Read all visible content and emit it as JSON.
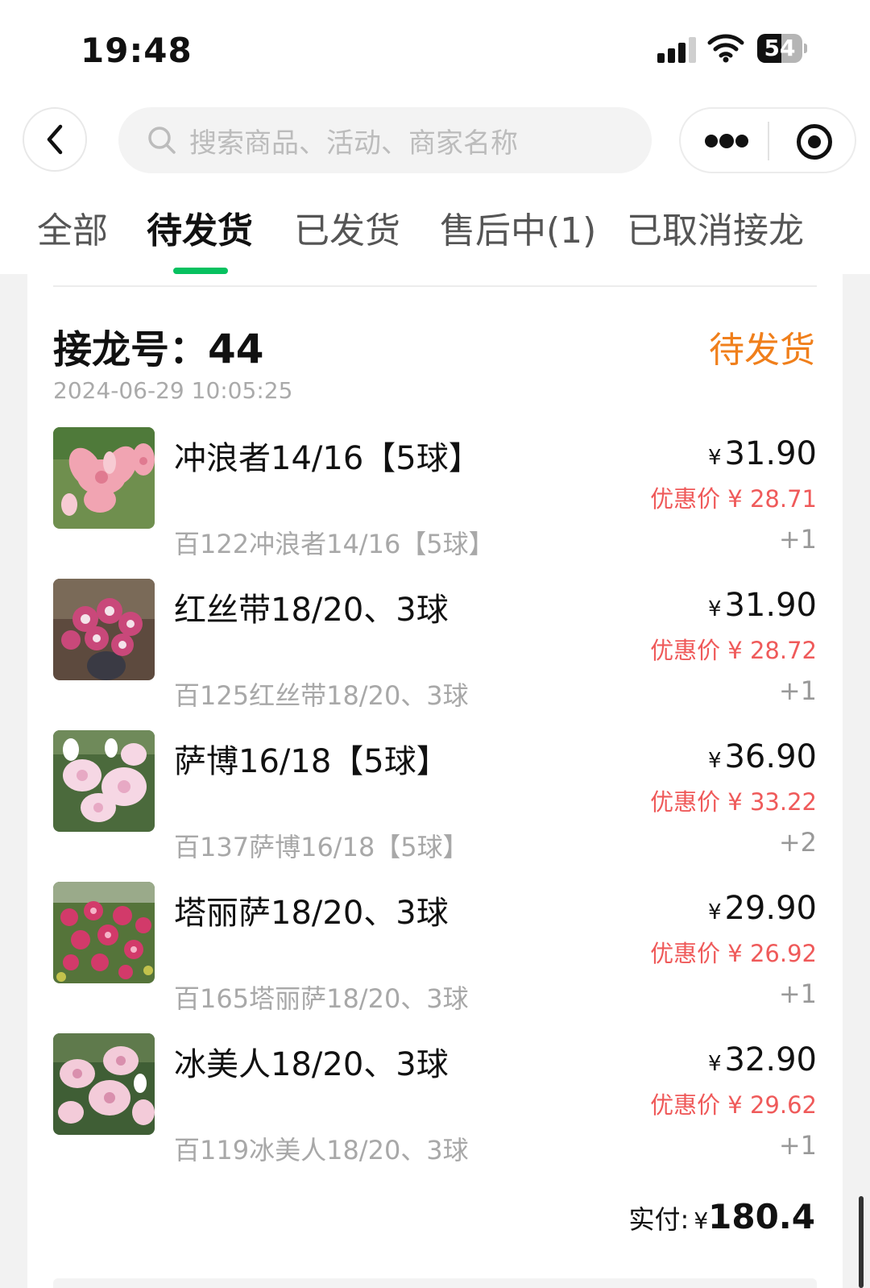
{
  "status_bar": {
    "time": "19:48",
    "battery": "54",
    "battery_level": 0.54
  },
  "search": {
    "placeholder": "搜索商品、活动、商家名称"
  },
  "tabs": [
    {
      "label": "全部"
    },
    {
      "label": "待发货",
      "active": true
    },
    {
      "label": "已发货"
    },
    {
      "label": "售后中(1)"
    },
    {
      "label": "已取消接龙"
    }
  ],
  "order": {
    "label": "接龙号：",
    "number": "44",
    "status": "待发货",
    "time": "2024-06-29 10:05:25",
    "items": [
      {
        "name": "冲浪者14/16【5球】",
        "sku": "百122冲浪者14/16【5球】",
        "currency": "¥",
        "price": "31.90",
        "discount": "优惠价 ¥ 28.71",
        "qty": "+1"
      },
      {
        "name": "红丝带18/20、3球",
        "sku": "百125红丝带18/20、3球",
        "currency": "¥",
        "price": "31.90",
        "discount": "优惠价 ¥ 28.72",
        "qty": "+1"
      },
      {
        "name": "萨博16/18【5球】",
        "sku": "百137萨博16/18【5球】",
        "currency": "¥",
        "price": "36.90",
        "discount": "优惠价 ¥ 33.22",
        "qty": "+2"
      },
      {
        "name": "塔丽萨18/20、3球",
        "sku": "百165塔丽萨18/20、3球",
        "currency": "¥",
        "price": "29.90",
        "discount": "优惠价 ¥ 26.92",
        "qty": "+1"
      },
      {
        "name": "冰美人18/20、3球",
        "sku": "百119冰美人18/20、3球",
        "currency": "¥",
        "price": "32.90",
        "discount": "优惠价 ¥ 29.62",
        "qty": "+1"
      }
    ],
    "total_label": "实付:",
    "total_currency": "¥",
    "total_value": "180.4"
  },
  "colors": {
    "accent_green": "#07c160",
    "status_orange": "#f07f1b",
    "discount_red": "#ef5a5a"
  },
  "icons": [
    "back-arrow-icon",
    "search-icon",
    "more-icon",
    "target-icon"
  ]
}
